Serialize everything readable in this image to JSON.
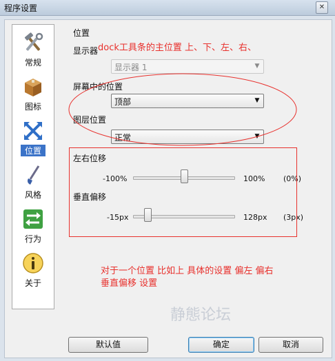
{
  "window": {
    "title": "程序设置",
    "close_glyph": "✕"
  },
  "sidebar": {
    "items": [
      {
        "label": "常规",
        "icon": "tools-icon"
      },
      {
        "label": "图标",
        "icon": "box-icon"
      },
      {
        "label": "位置",
        "icon": "position-arrows-icon",
        "active": true
      },
      {
        "label": "风格",
        "icon": "brush-icon"
      },
      {
        "label": "行为",
        "icon": "arrows-swap-icon"
      },
      {
        "label": "关于",
        "icon": "info-icon"
      }
    ]
  },
  "position_section": {
    "heading": "位置",
    "monitor_label": "显示器",
    "monitor_value": "显示器 1",
    "screen_pos_label": "屏幕中的位置",
    "screen_pos_value": "顶部",
    "layer_label": "图层位置",
    "layer_value": "正常"
  },
  "offset_section": {
    "horizontal_label": "左右位移",
    "horizontal_min": "-100%",
    "horizontal_max": "100%",
    "horizontal_value": "(0%)",
    "horizontal_level": 0.5,
    "vertical_label": "垂直偏移",
    "vertical_min": "-15px",
    "vertical_max": "128px",
    "vertical_value": "(3px)",
    "vertical_level": 0.126
  },
  "annotations": {
    "note1": "dock工具条的主位置 上、下、左、右、",
    "note2_line1": "对于一个位置 比如上 具体的设置 偏左 偏右",
    "note2_line2": "垂直偏移 设置",
    "color": "#e8302c"
  },
  "buttons": {
    "defaults": "默认值",
    "ok": "确定",
    "cancel": "取消"
  },
  "watermark": "静態论坛"
}
